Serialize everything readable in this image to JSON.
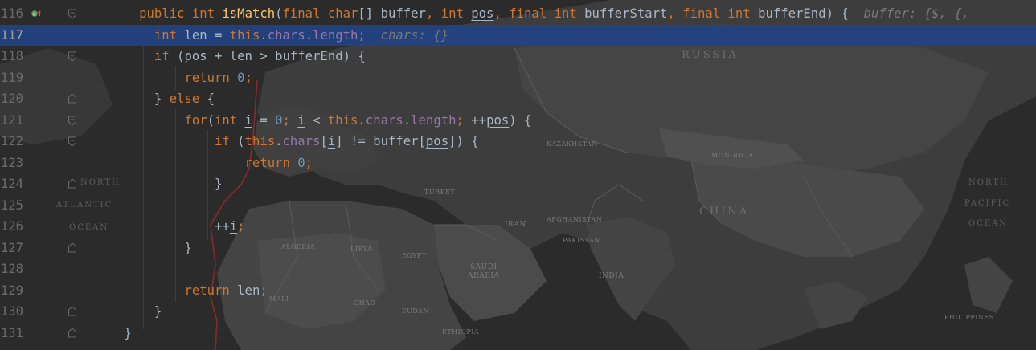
{
  "editor": {
    "lines": [
      {
        "number": "116",
        "current": false,
        "gutter_icon": "override-up-icon",
        "fold": "open",
        "tokens": [
          [
            "        ",
            "t"
          ],
          [
            "public",
            "kw"
          ],
          [
            " ",
            "t"
          ],
          [
            "int",
            "kw"
          ],
          [
            " ",
            "t"
          ],
          [
            "isMatch",
            "fn"
          ],
          [
            "(",
            "t"
          ],
          [
            "final",
            "kw"
          ],
          [
            " ",
            "t"
          ],
          [
            "char",
            "kw"
          ],
          [
            "[] buffer",
            "t"
          ],
          [
            ", ",
            "kw"
          ],
          [
            "int",
            "kw"
          ],
          [
            " ",
            "t"
          ],
          [
            "pos",
            "ul"
          ],
          [
            ", ",
            "kw"
          ],
          [
            "final",
            "kw"
          ],
          [
            " ",
            "t"
          ],
          [
            "int",
            "kw"
          ],
          [
            " bufferStart",
            "t"
          ],
          [
            ", ",
            "kw"
          ],
          [
            "final",
            "kw"
          ],
          [
            " ",
            "t"
          ],
          [
            "int",
            "kw"
          ],
          [
            " bufferEnd) {  ",
            "t"
          ],
          [
            "buffer: {$, {, ",
            "hint"
          ]
        ]
      },
      {
        "number": "117",
        "current": true,
        "gutter_icon": "",
        "fold": "",
        "tokens": [
          [
            "          ",
            "t"
          ],
          [
            "int",
            "kw"
          ],
          [
            " len = ",
            "t"
          ],
          [
            "this",
            "kw"
          ],
          [
            ".",
            "t"
          ],
          [
            "chars",
            "fld"
          ],
          [
            ".",
            "t"
          ],
          [
            "length",
            "fld"
          ],
          [
            ";",
            "kw"
          ],
          [
            "  ",
            "t"
          ],
          [
            "chars: {}",
            "hint"
          ]
        ]
      },
      {
        "number": "118",
        "current": false,
        "gutter_icon": "",
        "fold": "open",
        "tokens": [
          [
            "          ",
            "t"
          ],
          [
            "if",
            "kw"
          ],
          [
            " (pos + len > bufferEnd) {",
            "t"
          ]
        ]
      },
      {
        "number": "119",
        "current": false,
        "gutter_icon": "",
        "fold": "",
        "tokens": [
          [
            "              ",
            "t"
          ],
          [
            "return",
            "kw"
          ],
          [
            " ",
            "t"
          ],
          [
            "0",
            "num"
          ],
          [
            ";",
            "kw"
          ]
        ]
      },
      {
        "number": "120",
        "current": false,
        "gutter_icon": "",
        "fold": "close",
        "tokens": [
          [
            "          } ",
            "t"
          ],
          [
            "else",
            "kw"
          ],
          [
            " {",
            "t"
          ]
        ]
      },
      {
        "number": "121",
        "current": false,
        "gutter_icon": "",
        "fold": "open",
        "tokens": [
          [
            "              ",
            "t"
          ],
          [
            "for",
            "kw"
          ],
          [
            "(",
            "t"
          ],
          [
            "int",
            "kw"
          ],
          [
            " ",
            "t"
          ],
          [
            "i",
            "ul"
          ],
          [
            " = ",
            "t"
          ],
          [
            "0",
            "num"
          ],
          [
            "; ",
            "kw"
          ],
          [
            "i",
            "ul"
          ],
          [
            " < ",
            "t"
          ],
          [
            "this",
            "kw"
          ],
          [
            ".",
            "t"
          ],
          [
            "chars",
            "fld"
          ],
          [
            ".",
            "t"
          ],
          [
            "length",
            "fld"
          ],
          [
            "; ",
            "kw"
          ],
          [
            "++",
            "t"
          ],
          [
            "pos",
            "ul"
          ],
          [
            ") {",
            "t"
          ]
        ]
      },
      {
        "number": "122",
        "current": false,
        "gutter_icon": "",
        "fold": "open",
        "tokens": [
          [
            "                  ",
            "t"
          ],
          [
            "if",
            "kw"
          ],
          [
            " (",
            "t"
          ],
          [
            "this",
            "kw"
          ],
          [
            ".",
            "t"
          ],
          [
            "chars",
            "fld"
          ],
          [
            "[",
            "t"
          ],
          [
            "i",
            "ul"
          ],
          [
            "] != buffer[",
            "t"
          ],
          [
            "pos",
            "ul"
          ],
          [
            "]) {",
            "t"
          ]
        ]
      },
      {
        "number": "123",
        "current": false,
        "gutter_icon": "",
        "fold": "",
        "tokens": [
          [
            "                      ",
            "t"
          ],
          [
            "return",
            "kw"
          ],
          [
            " ",
            "t"
          ],
          [
            "0",
            "num"
          ],
          [
            ";",
            "kw"
          ]
        ]
      },
      {
        "number": "124",
        "current": false,
        "gutter_icon": "",
        "fold": "close",
        "tokens": [
          [
            "                  }",
            "t"
          ]
        ]
      },
      {
        "number": "125",
        "current": false,
        "gutter_icon": "",
        "fold": "",
        "tokens": []
      },
      {
        "number": "126",
        "current": false,
        "gutter_icon": "",
        "fold": "",
        "tokens": [
          [
            "                  ++",
            "t"
          ],
          [
            "i",
            "ul"
          ],
          [
            ";",
            "kw"
          ]
        ]
      },
      {
        "number": "127",
        "current": false,
        "gutter_icon": "",
        "fold": "close",
        "tokens": [
          [
            "              }",
            "t"
          ]
        ]
      },
      {
        "number": "128",
        "current": false,
        "gutter_icon": "",
        "fold": "",
        "tokens": []
      },
      {
        "number": "129",
        "current": false,
        "gutter_icon": "",
        "fold": "",
        "tokens": [
          [
            "              ",
            "t"
          ],
          [
            "return",
            "kw"
          ],
          [
            " len",
            "t"
          ],
          [
            ";",
            "kw"
          ]
        ]
      },
      {
        "number": "130",
        "current": false,
        "gutter_icon": "",
        "fold": "close",
        "tokens": [
          [
            "          }",
            "t"
          ]
        ]
      },
      {
        "number": "131",
        "current": false,
        "gutter_icon": "",
        "fold": "close",
        "tokens": [
          [
            "      }",
            "t"
          ]
        ]
      }
    ]
  },
  "map": {
    "labels": {
      "russia": "RUSSIA",
      "china": "CHINA",
      "mongolia": "MONGOLIA",
      "kazakhstan": "KAZAKHSTAN",
      "iran": "IRAN",
      "india": "INDIA",
      "saudi": "SAUDI",
      "arabia": "ARABIA",
      "egypt": "EGYPT",
      "libya": "LIBYA",
      "algeria": "ALGERIA",
      "sudan": "SUDAN",
      "ethiopia": "ETHIOPIA",
      "chad": "CHAD",
      "mali": "MALI",
      "turkey": "TURKEY",
      "pakistan": "PAKISTAN",
      "afghanistan": "AFGHANISTAN",
      "philippines": "PHILIPPINES",
      "north": "NORTH",
      "atlantic": "ATLANTIC",
      "ocean": "OCEAN",
      "north_r": "NORTH",
      "pacific": "PACIFIC",
      "ocean_r": "OCEAN"
    },
    "colors": {
      "land": "#474747",
      "land_dark": "#3a3a3a",
      "border": "#5c5c5c",
      "route": "#8a2a2a"
    }
  }
}
